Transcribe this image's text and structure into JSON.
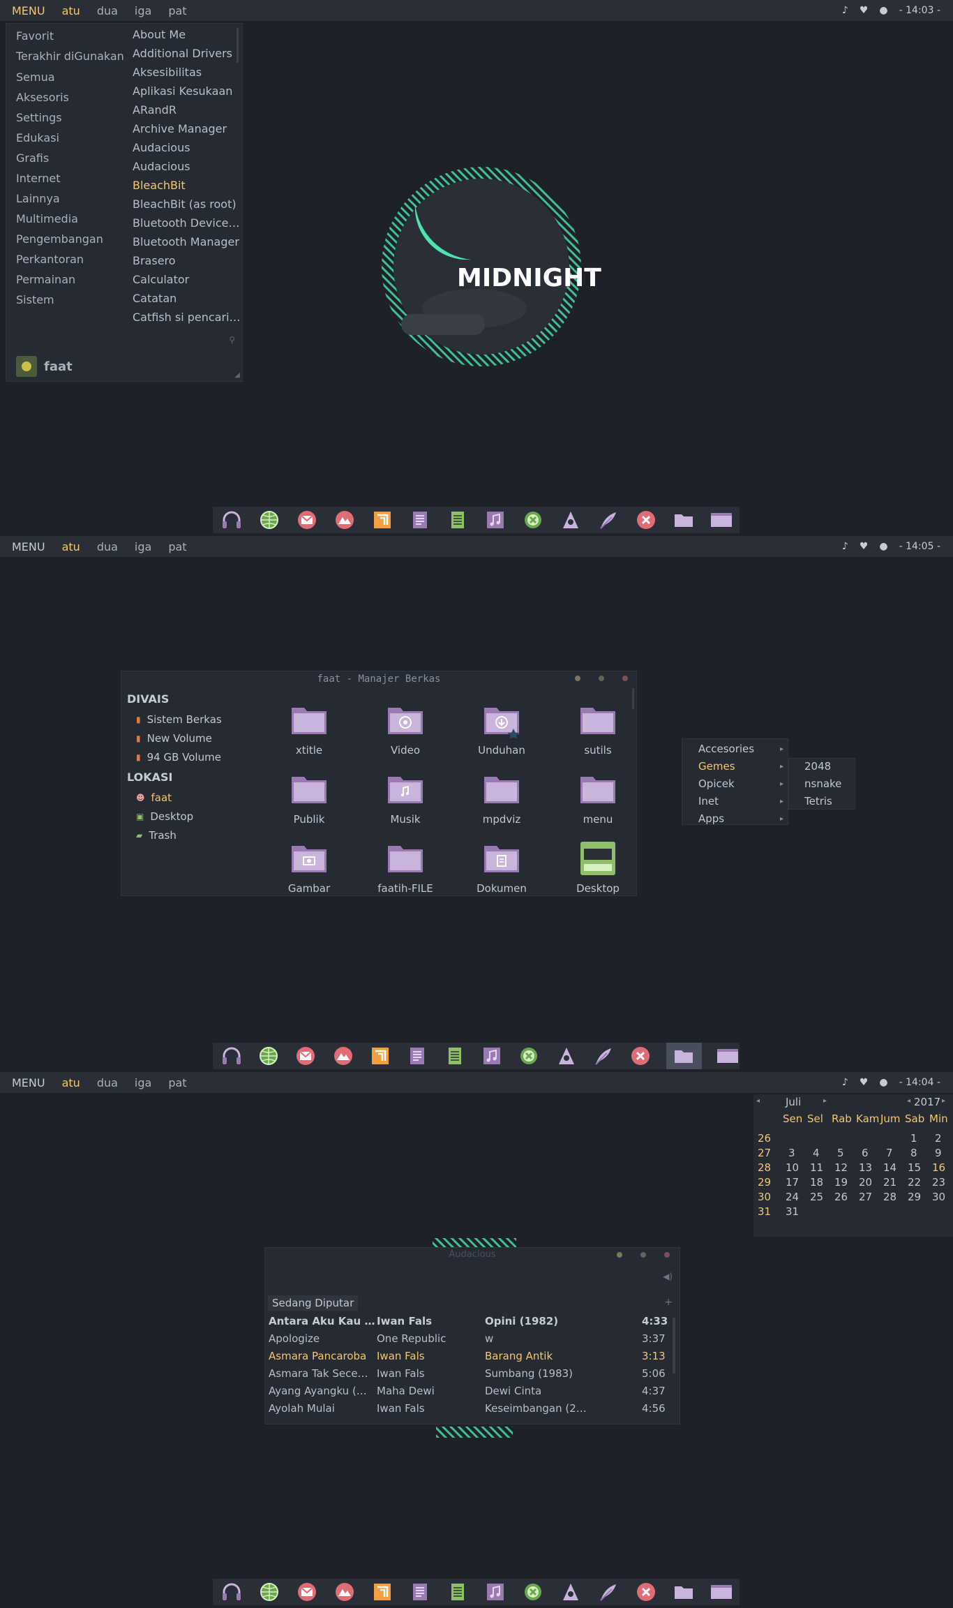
{
  "colors": {
    "bg": "#1e2128",
    "bar": "#2a2e36",
    "accent": "#f3c86d",
    "mint": "#4ee3ae",
    "purple": "#9a7ab2"
  },
  "panel1": {
    "topbar": {
      "menu": "MENU",
      "workspaces": [
        "atu",
        "dua",
        "iga",
        "pat"
      ],
      "clock": "- 14:03 -"
    },
    "menu": {
      "categories": [
        "Favorit",
        "Terakhir diGunakan",
        "Semua",
        "Aksesoris",
        "Settings",
        "Edukasi",
        "Grafis",
        "Internet",
        "Lainnya",
        "Multimedia",
        "Pengembangan",
        "Perkantoran",
        "Permainan",
        "Sistem"
      ],
      "apps": [
        "About Me",
        "Additional Drivers",
        "Aksesibilitas",
        "Aplikasi Kesukaan",
        "ARandR",
        "Archive Manager",
        "Audacious",
        "Audacious",
        "BleachBit",
        "BleachBit (as root)",
        "Bluetooth Device…",
        "Bluetooth Manager",
        "Brasero",
        "Calculator",
        "Catatan",
        "Catfish si pencari…"
      ],
      "highlighted": "BleachBit",
      "user": "faat"
    },
    "logo_text": "MIDNIGHT"
  },
  "panel2": {
    "topbar": {
      "menu": "MENU",
      "workspaces": [
        "atu",
        "dua",
        "iga",
        "pat"
      ],
      "clock": "- 14:05 -"
    },
    "filemanager": {
      "title": "faat - Manajer Berkas",
      "devices_header": "DIVAIS",
      "devices": [
        "Sistem Berkas",
        "New Volume",
        "94 GB Volume"
      ],
      "places_header": "LOKASI",
      "places": [
        "faat",
        "Desktop",
        "Trash"
      ],
      "folders": [
        "xtitle",
        "Video",
        "Unduhan",
        "sutils",
        "Publik",
        "Musik",
        "mpdviz",
        "menu",
        "Gambar",
        "faatih-FILE",
        "Dokumen",
        "Desktop"
      ]
    },
    "context_menu": {
      "items": [
        "Accesories",
        "Gemes",
        "Opicek",
        "Inet",
        "Apps"
      ],
      "highlighted": "Gemes",
      "submenu": [
        "2048",
        "nsnake",
        "Tetris"
      ]
    }
  },
  "panel3": {
    "topbar": {
      "menu": "MENU",
      "workspaces": [
        "atu",
        "dua",
        "iga",
        "pat"
      ],
      "clock": "- 14:04 -"
    },
    "calendar": {
      "month": "Juli",
      "year": "2017",
      "days": [
        "Sen",
        "Sel",
        "Rab",
        "Kam",
        "Jum",
        "Sab",
        "Min"
      ],
      "weeks": [
        {
          "wk": "26",
          "d": [
            "",
            "",
            "",
            "",
            "",
            "1",
            "2"
          ]
        },
        {
          "wk": "27",
          "d": [
            "3",
            "4",
            "5",
            "6",
            "7",
            "8",
            "9"
          ]
        },
        {
          "wk": "28",
          "d": [
            "10",
            "11",
            "12",
            "13",
            "14",
            "15",
            "16"
          ]
        },
        {
          "wk": "29",
          "d": [
            "17",
            "18",
            "19",
            "20",
            "21",
            "22",
            "23"
          ]
        },
        {
          "wk": "30",
          "d": [
            "24",
            "25",
            "26",
            "27",
            "28",
            "29",
            "30"
          ]
        },
        {
          "wk": "31",
          "d": [
            "31",
            "",
            "",
            "",
            "",
            "",
            ""
          ]
        }
      ],
      "today": "16"
    },
    "audacious": {
      "title": "Audacious",
      "tab": "Sedang Diputar",
      "rows": [
        {
          "t": "Antara Aku Kau …",
          "a": "Iwan Fals",
          "al": "Opini (1982)",
          "d": "4:33",
          "style": "bold"
        },
        {
          "t": "Apologize",
          "a": "One Republic",
          "al": "w",
          "d": "3:37",
          "style": ""
        },
        {
          "t": "Asmara Pancaroba",
          "a": "Iwan Fals",
          "al": "Barang Antik",
          "d": "3:13",
          "style": "hl"
        },
        {
          "t": "Asmara Tak Sece…",
          "a": "Iwan Fals",
          "al": "Sumbang (1983)",
          "d": "5:06",
          "style": ""
        },
        {
          "t": "Ayang Ayangku (…",
          "a": "Maha Dewi",
          "al": "Dewi Cinta",
          "d": "4:37",
          "style": ""
        },
        {
          "t": "Ayolah Mulai",
          "a": "Iwan Fals",
          "al": "Keseimbangan (2…",
          "d": "4:56",
          "style": ""
        }
      ]
    }
  },
  "dock_icons": [
    "headphones-icon",
    "globe-icon",
    "mail-icon",
    "photo-icon",
    "slides-icon",
    "document-icon",
    "spreadsheet-icon",
    "music-icon",
    "close-circle-icon",
    "vlc-icon",
    "feather-icon",
    "x-icon",
    "folder-icon",
    "window-icon"
  ]
}
